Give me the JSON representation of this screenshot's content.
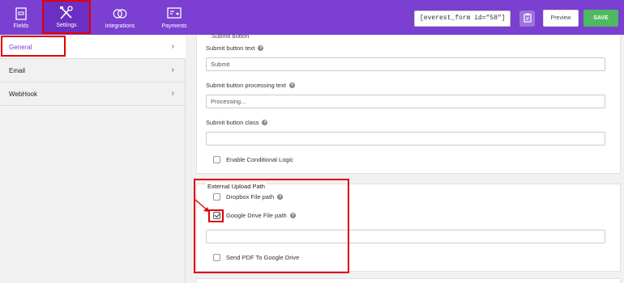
{
  "topbar": {
    "tabs": [
      {
        "label": "Fields",
        "icon": "fields-icon"
      },
      {
        "label": "Settings",
        "icon": "settings-tools-icon"
      },
      {
        "label": "Integrations",
        "icon": "integrations-icon"
      },
      {
        "label": "Payments",
        "icon": "payments-icon"
      }
    ],
    "shortcode": "[everest_form id=\"58\"]",
    "preview_label": "Preview",
    "save_label": "SAVE"
  },
  "sidebar": {
    "items": [
      {
        "label": "General",
        "active": true
      },
      {
        "label": "Email"
      },
      {
        "label": "WebHook"
      }
    ]
  },
  "main": {
    "submit_section_title": "Submit button",
    "submit_text": {
      "label": "Submit button text",
      "value": "Submit"
    },
    "submit_processing": {
      "label": "Submit button processing text",
      "value": "Processing..."
    },
    "submit_class": {
      "label": "Submit button class",
      "value": ""
    },
    "conditional_logic": {
      "label": "Enable Conditional Logic",
      "checked": false
    },
    "upload": {
      "title": "External Upload Path",
      "dropbox": {
        "label": "Dropbox File path",
        "checked": false
      },
      "gdrive": {
        "label": "Google Drive File path",
        "checked": true,
        "value": ""
      },
      "send_pdf": {
        "label": "Send PDF To Google Drive",
        "checked": false
      }
    }
  },
  "colors": {
    "brand": "#7b3fd1",
    "save": "#4db960",
    "highlight": "#e00000"
  }
}
